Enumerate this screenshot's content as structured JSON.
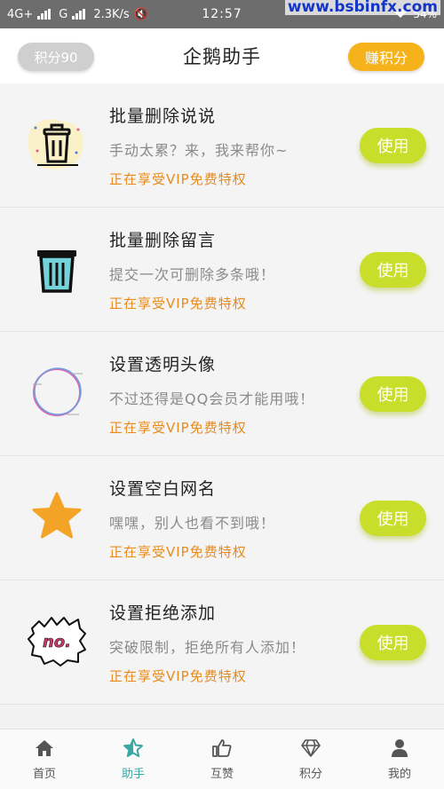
{
  "status_bar": {
    "network": "4G+",
    "carrier2": "G",
    "speed": "2.3K/s",
    "time": "12:57",
    "battery": "54%",
    "watermark": "www.bsbinfx.com"
  },
  "header": {
    "title": "企鹅助手",
    "points_label": "积分90",
    "earn_label": "赚积分"
  },
  "features": [
    {
      "title": "批量删除说说",
      "desc": "手动太累？来，我来帮你~",
      "vip": "正在享受VIP免费特权",
      "button": "使用",
      "icon": "trash-can-icon"
    },
    {
      "title": "批量删除留言",
      "desc": "提交一次可删除多条哦！",
      "vip": "正在享受VIP免费特权",
      "button": "使用",
      "icon": "trash-bin-icon"
    },
    {
      "title": "设置透明头像",
      "desc": "不过还得是QQ会员才能用哦！",
      "vip": "正在享受VIP免费特权",
      "button": "使用",
      "icon": "transparent-circle-icon"
    },
    {
      "title": "设置空白网名",
      "desc": "嘿嘿，别人也看不到哦！",
      "vip": "正在享受VIP免费特权",
      "button": "使用",
      "icon": "star-icon"
    },
    {
      "title": "设置拒绝添加",
      "desc": "突破限制，拒绝所有人添加！",
      "vip": "正在享受VIP免费特权",
      "button": "使用",
      "icon": "no-stamp-icon"
    }
  ],
  "tabs": [
    {
      "label": "首页",
      "icon": "home-icon"
    },
    {
      "label": "助手",
      "icon": "star-outline-icon"
    },
    {
      "label": "互赞",
      "icon": "thumbs-up-icon"
    },
    {
      "label": "积分",
      "icon": "diamond-icon"
    },
    {
      "label": "我的",
      "icon": "person-icon"
    }
  ],
  "active_tab": "助手",
  "colors": {
    "accent": "#3aa8a2",
    "use_button": "#c9dd2b",
    "earn_button": "#f6b21a",
    "vip_text": "#e88a1c"
  },
  "no_stamp_text": "no."
}
